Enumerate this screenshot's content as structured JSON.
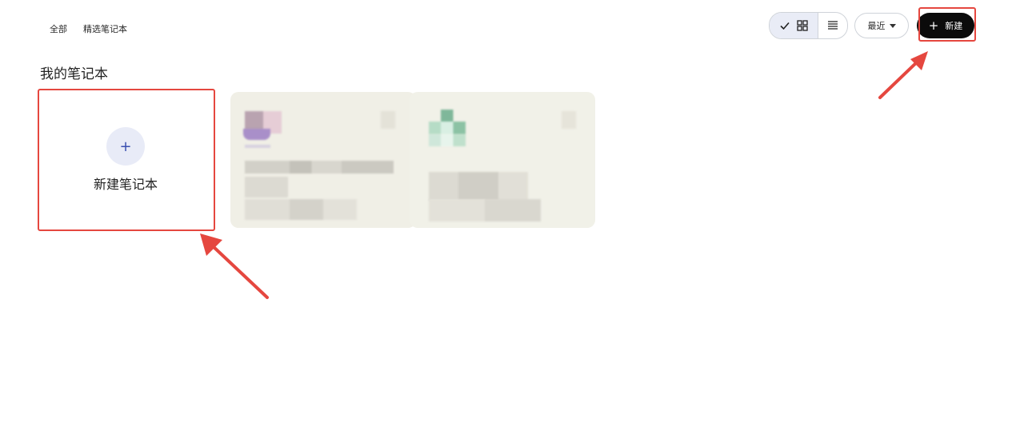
{
  "nav": {
    "tabs": [
      {
        "label": "全部"
      },
      {
        "label": "精选笔记本"
      }
    ]
  },
  "toolbar": {
    "sort_label": "最近",
    "new_label": "新建"
  },
  "section": {
    "title": "我的笔记本"
  },
  "create_card": {
    "label": "新建笔记本"
  },
  "colors": {
    "highlight": "#e5473f",
    "new_button_bg": "#0b0b0b",
    "card_bg": "#f0efe6",
    "grid_toggle_bg": "#e9ecf6"
  }
}
